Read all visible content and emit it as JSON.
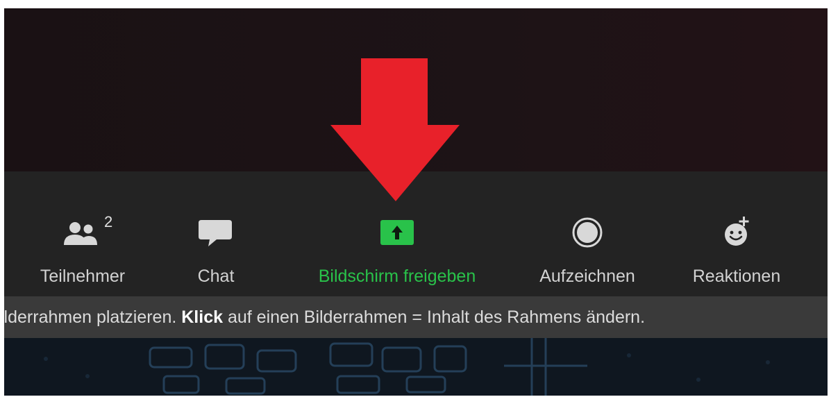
{
  "toolbar": {
    "participants": {
      "label": "Teilnehmer",
      "count": "2",
      "icon": "participants-icon"
    },
    "chat": {
      "label": "Chat",
      "icon": "chat-bubble-icon"
    },
    "share": {
      "label": "Bildschirm freigeben",
      "icon": "share-screen-icon",
      "accent": "#29c24a"
    },
    "record": {
      "label": "Aufzeichnen",
      "icon": "record-icon"
    },
    "reactions": {
      "label": "Reaktionen",
      "icon": "add-reaction-icon"
    }
  },
  "status": {
    "part1": "ilderrahmen platzieren. ",
    "bold": "Klick",
    "part2": " auf einen Bilderrahmen = Inhalt des Rahmens ändern."
  },
  "annotation": {
    "arrow_color": "#e8212a"
  }
}
